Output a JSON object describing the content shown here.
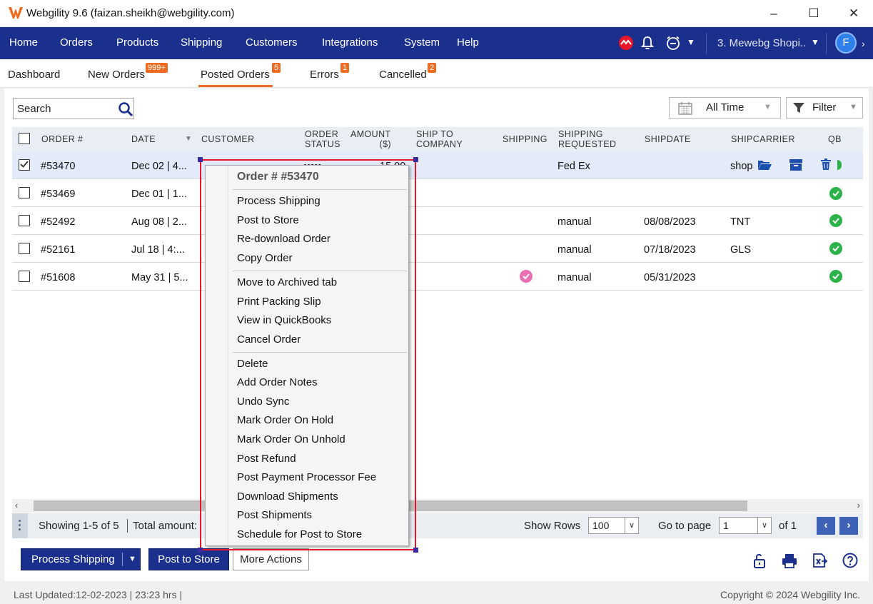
{
  "window": {
    "title": "Webgility 9.6 (faizan.sheikh@webgility.com)",
    "minimize": "–",
    "maximize": "☐",
    "close": "✕"
  },
  "nav": {
    "items": [
      "Home",
      "Orders",
      "Products",
      "Shipping",
      "Customers",
      "Integrations",
      "System",
      "Help"
    ],
    "store": "3. Mewebg Shopi..",
    "avatar": "F"
  },
  "tabs": [
    {
      "label": "Dashboard",
      "badge": ""
    },
    {
      "label": "New Orders",
      "badge": "999+"
    },
    {
      "label": "Posted Orders",
      "badge": "5"
    },
    {
      "label": "Errors",
      "badge": "1"
    },
    {
      "label": "Cancelled",
      "badge": "2"
    }
  ],
  "toolbar": {
    "search_placeholder": "Search",
    "time_filter": "All Time",
    "filter_label": "Filter"
  },
  "table": {
    "headers": {
      "order": "ORDER #",
      "date": "DATE",
      "customer": "CUSTOMER",
      "order_status_1": "ORDER",
      "order_status_2": "STATUS",
      "amount_1": "AMOUNT",
      "amount_2": "($)",
      "ship_to_1": "SHIP TO",
      "ship_to_2": "COMPANY",
      "shipping": "SHIPPING",
      "ship_req_1": "SHIPPING",
      "ship_req_2": "REQUESTED",
      "shipdate": "SHIPDATE",
      "shipcarrier": "SHIPCARRIER",
      "qb": "QB"
    },
    "rows": [
      {
        "order": "#53470",
        "date": "Dec 02 | 4...",
        "status": "•••••",
        "amount": "15.00",
        "ship_req": "Fed Ex",
        "shipdate": "",
        "carrier": "shop",
        "checked": true
      },
      {
        "order": "#53469",
        "date": "Dec 01 | 1...",
        "ship_req": "",
        "shipdate": "",
        "carrier": "",
        "checked": false
      },
      {
        "order": "#52492",
        "date": "Aug 08 | 2...",
        "ship_req": "manual",
        "shipdate": "08/08/2023",
        "carrier": "TNT",
        "checked": false
      },
      {
        "order": "#52161",
        "date": "Jul 18 | 4:...",
        "ship_req": "manual",
        "shipdate": "07/18/2023",
        "carrier": "GLS",
        "checked": false
      },
      {
        "order": "#51608",
        "date": "May 31 | 5...",
        "ship_req": "manual",
        "shipdate": "05/31/2023",
        "carrier": "",
        "checked": false
      }
    ]
  },
  "pager": {
    "showing": "Showing 1-5 of 5",
    "total": "Total amount:",
    "show_rows_label": "Show Rows",
    "show_rows_value": "100",
    "goto_label": "Go to page",
    "goto_value": "1",
    "of_pages": "of 1"
  },
  "actions": {
    "process_shipping": "Process Shipping",
    "post_to_store": "Post to Store",
    "more_actions": "More Actions"
  },
  "status": {
    "last_updated": "Last Updated:12-02-2023 | 23:23 hrs |",
    "copyright": "Copyright © 2024 Webgility Inc."
  },
  "context_menu": {
    "header": "Order # #53470",
    "group1": [
      "Process Shipping",
      "Post to Store",
      "Re-download Order",
      "Copy Order"
    ],
    "group2": [
      "Move to Archived tab",
      "Print Packing Slip",
      "View in QuickBooks",
      "Cancel Order"
    ],
    "group3": [
      "Delete",
      "Add Order Notes",
      "Undo Sync",
      "Mark Order On Hold",
      "Mark Order On Unhold",
      "Post Refund",
      "Post Payment Processor Fee",
      "Download Shipments",
      "Post Shipments",
      "Schedule for Post to Store"
    ]
  },
  "colors": {
    "nav_bg": "#1b2f8c",
    "accent_orange": "#ef6b1f",
    "success_green": "#2bb34a",
    "highlight_red": "#e8162a"
  }
}
